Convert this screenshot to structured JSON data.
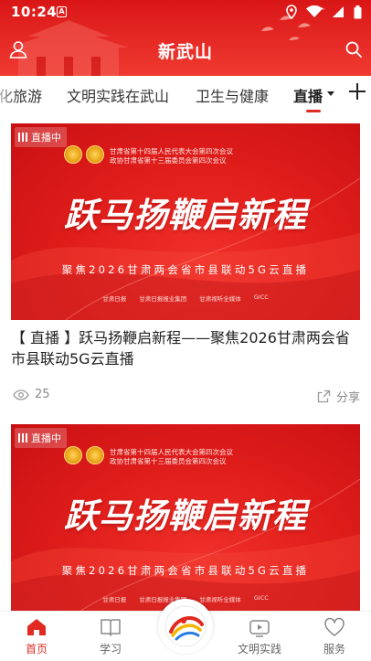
{
  "status_bar": {
    "time": "10:24",
    "notification_icon": "a-icon"
  },
  "header": {
    "title": "新武山",
    "left_icon": "user-icon",
    "right_icon": "search-icon"
  },
  "tabs": [
    {
      "label": "化旅游"
    },
    {
      "label": "文明实践在武山"
    },
    {
      "label": "卫生与健康"
    },
    {
      "label": "直播",
      "active": true
    }
  ],
  "cards": [
    {
      "badge": "直播中",
      "banner_meeting_line1": "甘肃省第十四届人民代表大会第四次会议",
      "banner_meeting_line2": "政协甘肃省第十三届委员会第四次会议",
      "banner_title": "跃马扬鞭启新程",
      "banner_subtitle": "聚焦2026甘肃两会省市县联动5G云直播",
      "sponsors": [
        "甘肃日报",
        "甘肃日报报业集团",
        "甘肃视听全媒体",
        "GICC"
      ],
      "title": "【 直播 】跃马扬鞭启新程——聚焦2026甘肃两会省市县联动5G云直播",
      "views": "25",
      "share_label": "分享"
    },
    {
      "badge": "直播中",
      "banner_meeting_line1": "甘肃省第十四届人民代表大会第四次会议",
      "banner_meeting_line2": "政协甘肃省第十三届委员会第四次会议",
      "banner_title": "跃马扬鞭启新程",
      "banner_subtitle": "聚焦2026甘肃两会省市县联动5G云直播",
      "sponsors": [
        "甘肃日报",
        "甘肃日报报业集团",
        "甘肃视听全媒体",
        "GICC"
      ]
    }
  ],
  "bottom_nav": [
    {
      "label": "首页",
      "icon": "home-icon",
      "active": true
    },
    {
      "label": "学习",
      "icon": "book-icon"
    },
    {
      "label": "",
      "icon": "wushan-logo-icon"
    },
    {
      "label": "文明实践",
      "icon": "video-icon"
    },
    {
      "label": "服务",
      "icon": "heart-icon"
    }
  ],
  "colors": {
    "brand_red": "#e02a22",
    "header_red": "#d91616"
  }
}
